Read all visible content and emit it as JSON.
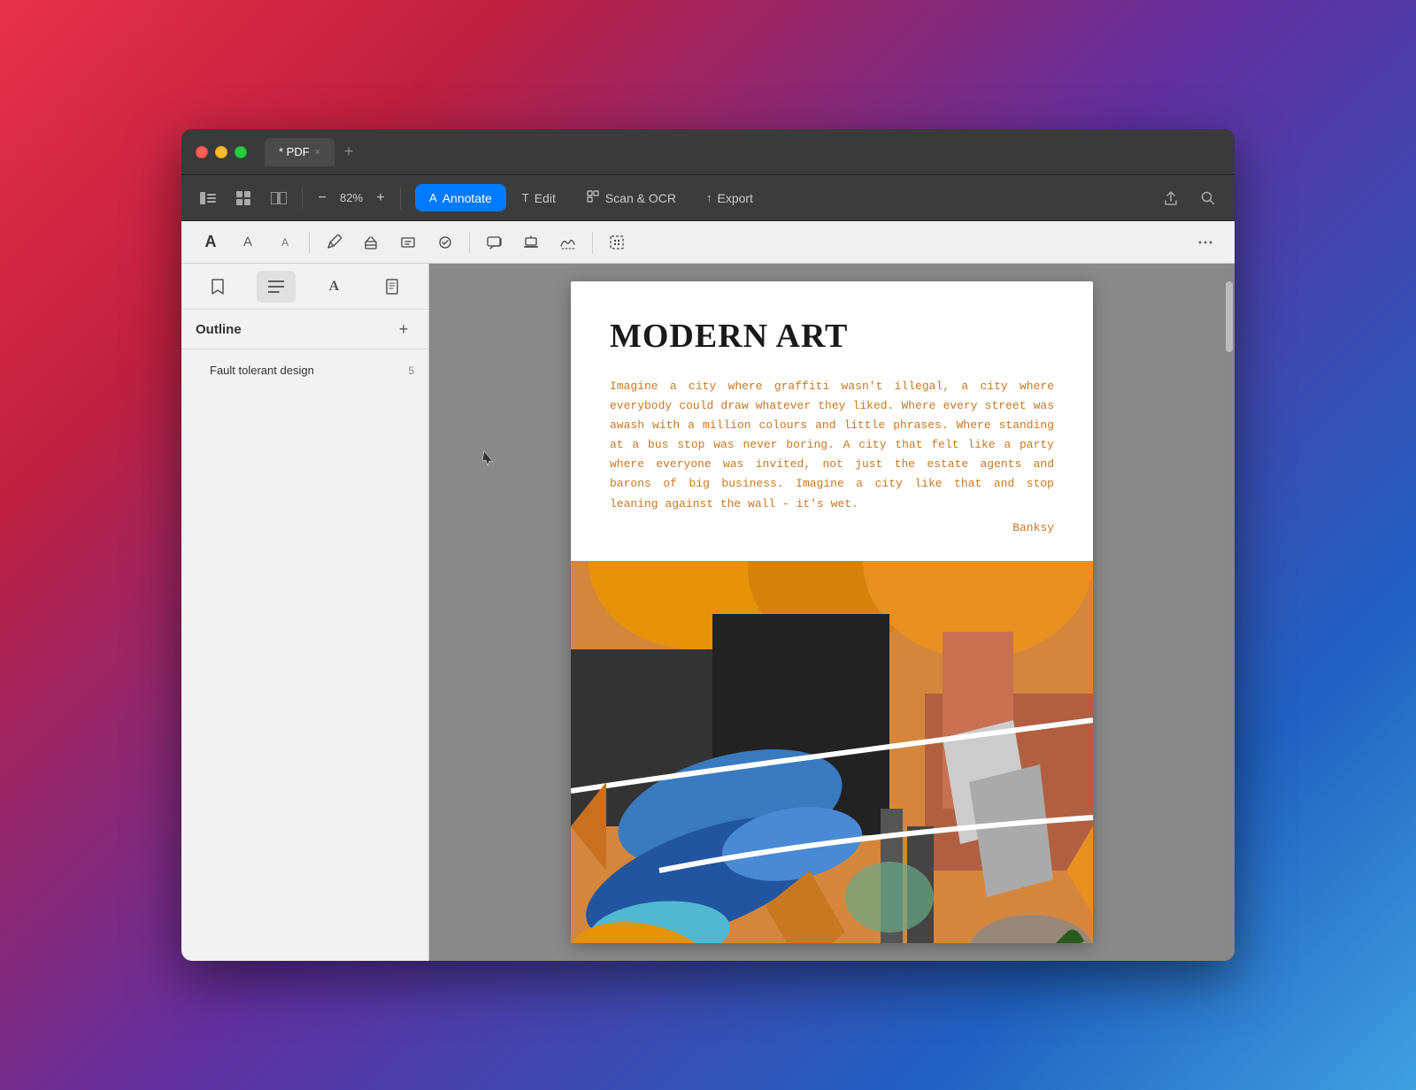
{
  "window": {
    "title": "* PDF",
    "tab_close": "×",
    "tab_add": "+"
  },
  "traffic_lights": {
    "close": "close",
    "minimize": "minimize",
    "maximize": "maximize"
  },
  "toolbar": {
    "sidebar_toggle": "☰",
    "grid_view": "⊞",
    "dual_page": "⧉",
    "zoom_level": "82%",
    "zoom_out": "−",
    "zoom_in": "+"
  },
  "mode_tabs": [
    {
      "id": "annotate",
      "label": "Annotate",
      "icon": "A",
      "active": true
    },
    {
      "id": "edit",
      "label": "Edit",
      "icon": "T",
      "active": false
    },
    {
      "id": "scan_ocr",
      "label": "Scan & OCR",
      "icon": "⊡",
      "active": false
    },
    {
      "id": "export",
      "label": "Export",
      "icon": "↑",
      "active": false
    }
  ],
  "annotation_tools": [
    {
      "id": "text-bold",
      "icon": "A",
      "style": "bold"
    },
    {
      "id": "text-normal",
      "icon": "A",
      "style": "normal"
    },
    {
      "id": "text-small",
      "icon": "A",
      "style": "small"
    },
    {
      "id": "pen",
      "icon": "✒"
    },
    {
      "id": "eraser",
      "icon": "⬚"
    },
    {
      "id": "text-box",
      "icon": "T"
    },
    {
      "id": "shape",
      "icon": "○"
    },
    {
      "id": "comment",
      "icon": "💬"
    },
    {
      "id": "stamp",
      "icon": "⬇"
    },
    {
      "id": "signature",
      "icon": "✍"
    },
    {
      "id": "selection",
      "icon": "⬚"
    }
  ],
  "sidebar": {
    "tabs": [
      {
        "id": "bookmark",
        "icon": "🔖"
      },
      {
        "id": "outline",
        "icon": "☰",
        "active": true
      },
      {
        "id": "text",
        "icon": "A"
      },
      {
        "id": "page",
        "icon": "📄"
      }
    ],
    "title": "Outline",
    "add_button": "+",
    "items": [
      {
        "label": "Fault tolerant design",
        "page": "5"
      }
    ]
  },
  "pdf": {
    "title": "MODERN ART",
    "quote": "Imagine a city where graffiti wasn't illegal, a city where everybody could draw whatever they liked. Where every street was awash with a million colours and little phrases. Where standing at a bus stop was never boring. A city that felt like a party where everyone was invited, not just the estate agents and barons of big business. Imagine a city like that and stop leaning against the wall - it's wet.",
    "attribution": "Banksy"
  }
}
